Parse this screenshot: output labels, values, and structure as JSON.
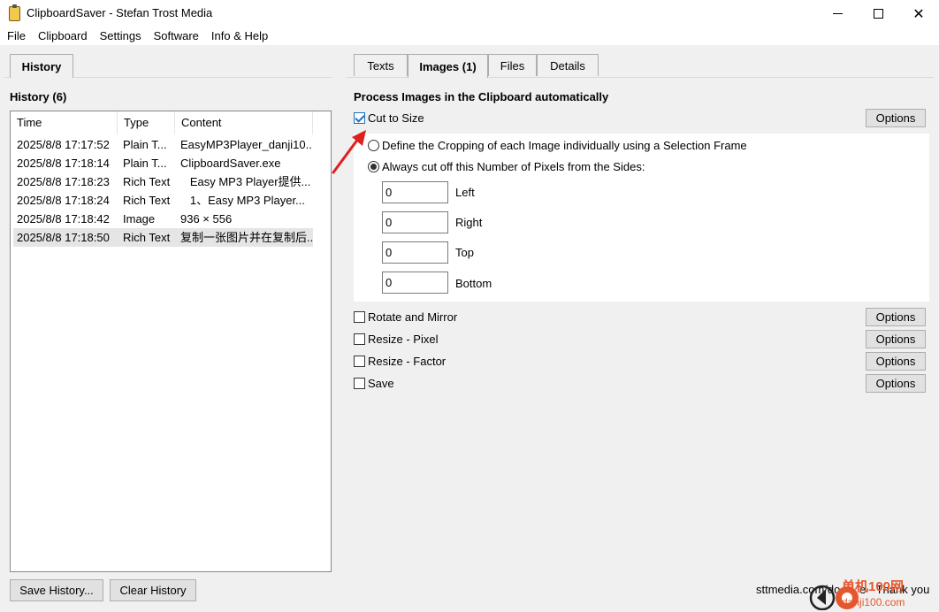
{
  "window": {
    "title": "ClipboardSaver - Stefan Trost Media"
  },
  "menu": [
    "File",
    "Clipboard",
    "Settings",
    "Software",
    "Info & Help"
  ],
  "left_tab": "History",
  "history": {
    "heading": "History (6)",
    "columns": [
      "Time",
      "Type",
      "Content"
    ],
    "rows": [
      {
        "time": "2025/8/8 17:17:52",
        "type": "Plain T...",
        "content": "EasyMP3Player_danji10..."
      },
      {
        "time": "2025/8/8 17:18:14",
        "type": "Plain T...",
        "content": "ClipboardSaver.exe"
      },
      {
        "time": "2025/8/8 17:18:23",
        "type": "Rich Text",
        "content": "   Easy MP3 Player提供..."
      },
      {
        "time": "2025/8/8 17:18:24",
        "type": "Rich Text",
        "content": "   1、Easy MP3 Player..."
      },
      {
        "time": "2025/8/8 17:18:42",
        "type": "Image",
        "content": "936 × 556"
      },
      {
        "time": "2025/8/8 17:18:50",
        "type": "Rich Text",
        "content": "复制一张图片并在复制后..."
      }
    ],
    "selected_index": 5,
    "save_button": "Save History...",
    "clear_button": "Clear History"
  },
  "right_tabs": [
    "Texts",
    "Images (1)",
    "Files",
    "Details"
  ],
  "active_right_tab": 1,
  "images": {
    "heading": "Process Images in the Clipboard automatically",
    "cut_to_size": {
      "label": "Cut to Size",
      "checked": true,
      "options_label": "Options"
    },
    "radio_define": "Define the Cropping of each Image individually using a Selection Frame",
    "radio_always": "Always cut off this Number of Pixels from the Sides:",
    "radio_selected": "always",
    "sides": [
      {
        "label": "Left",
        "value": "0"
      },
      {
        "label": "Right",
        "value": "0"
      },
      {
        "label": "Top",
        "value": "0"
      },
      {
        "label": "Bottom",
        "value": "0"
      }
    ],
    "rotate": {
      "label": "Rotate and Mirror",
      "checked": false,
      "options_label": "Options"
    },
    "resize_pixel": {
      "label": "Resize - Pixel",
      "checked": false,
      "options_label": "Options"
    },
    "resize_factor": {
      "label": "Resize - Factor",
      "checked": false,
      "options_label": "Options"
    },
    "save": {
      "label": "Save",
      "checked": false,
      "options_label": "Options"
    }
  },
  "footer": {
    "link": "sttmedia.com/do      e - Thank you"
  },
  "watermark": {
    "text1": "单机100网",
    "text2": "danji100.com"
  },
  "colors": {
    "accent": "#1f6fbf",
    "arrow": "#e02020",
    "watermark": "#e4572e"
  }
}
